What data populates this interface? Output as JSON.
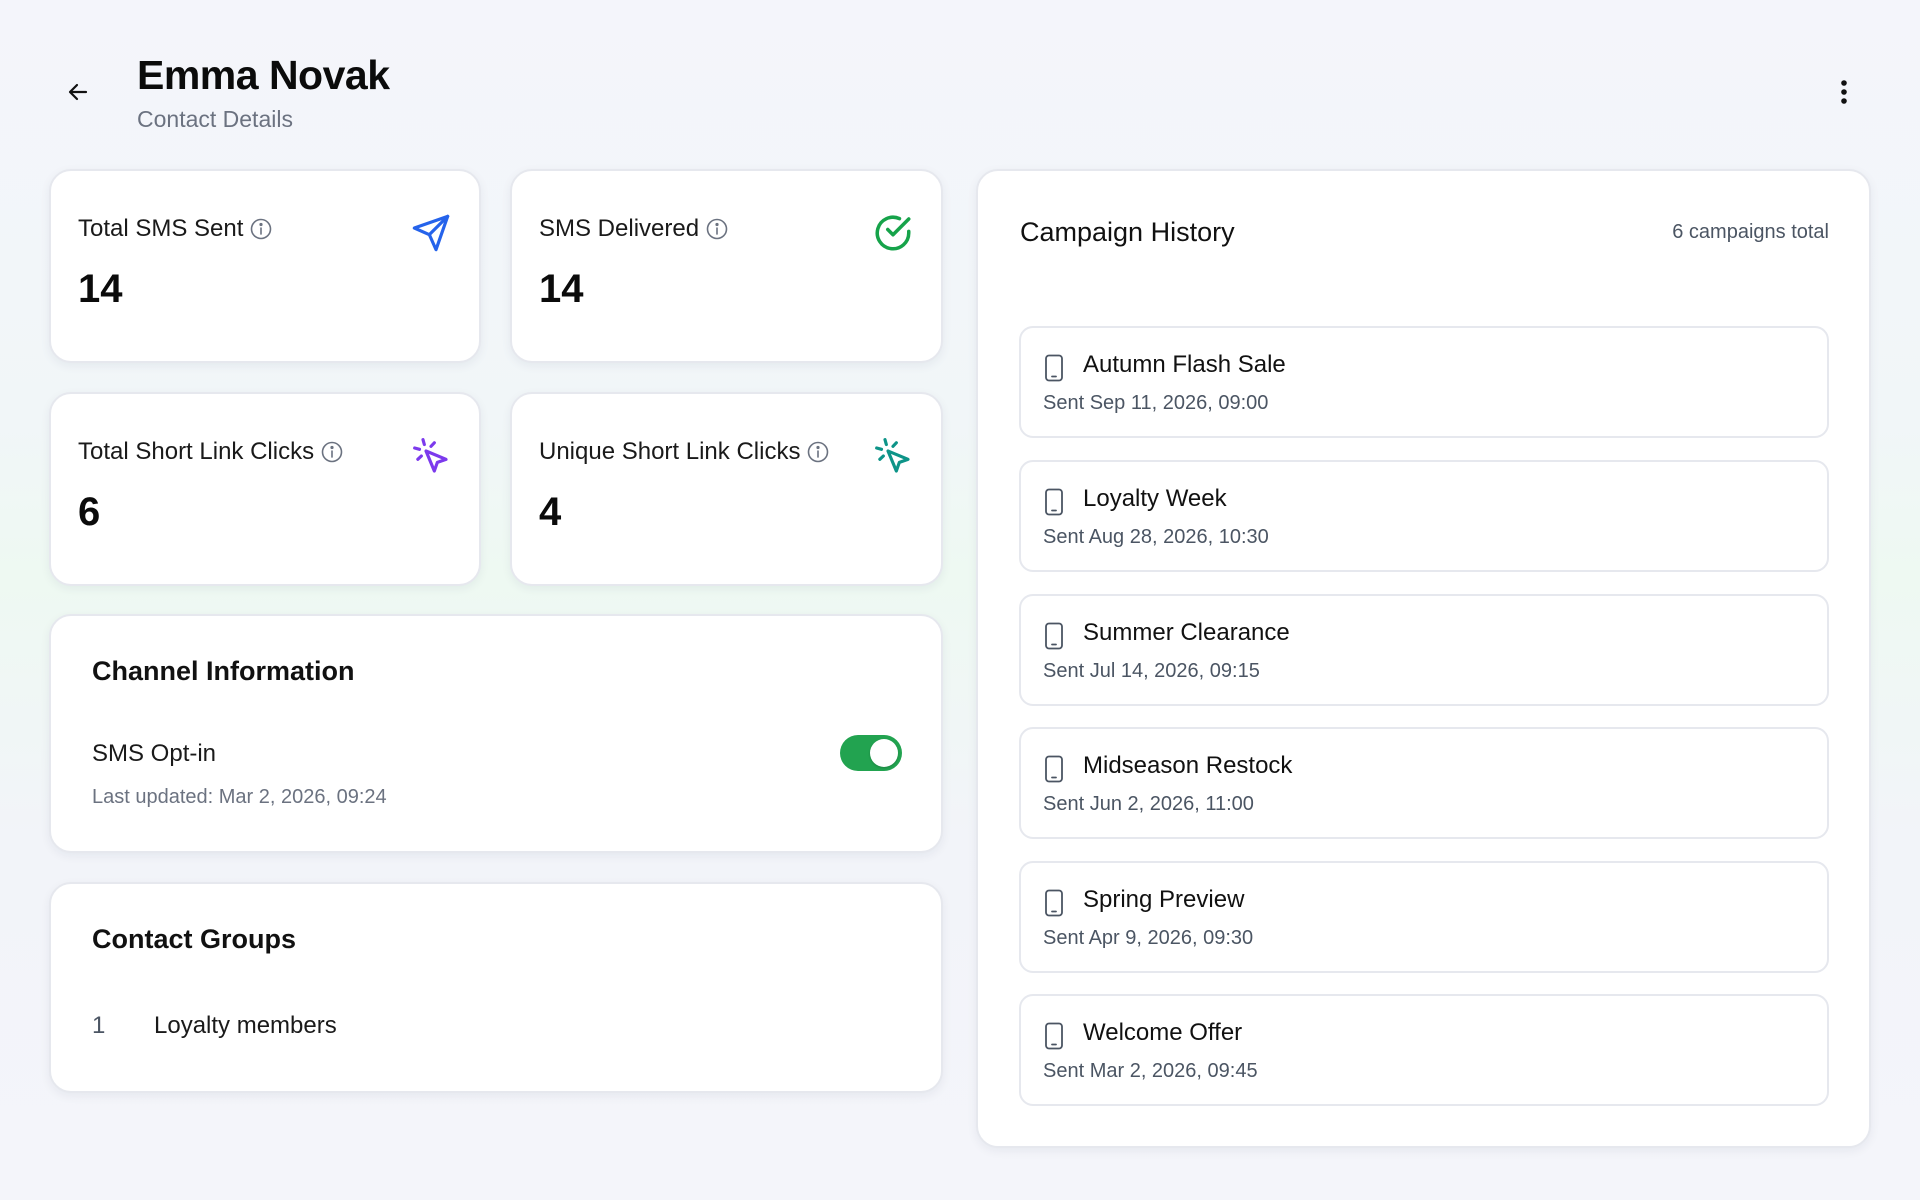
{
  "header": {
    "title": "Emma Novak",
    "subtitle": "Contact Details"
  },
  "stats": [
    {
      "label": "Total SMS Sent",
      "value": "14",
      "icon": "send-icon",
      "color": "#2563eb"
    },
    {
      "label": "SMS Delivered",
      "value": "14",
      "icon": "check-circle-icon",
      "color": "#16a34a"
    },
    {
      "label": "Total Short Link Clicks",
      "value": "6",
      "icon": "cursor-click-icon",
      "color": "#7c3aed"
    },
    {
      "label": "Unique Short Link Clicks",
      "value": "4",
      "icon": "cursor-click-icon",
      "color": "#0d9488"
    }
  ],
  "channel": {
    "title": "Channel Information",
    "optin_label": "SMS Opt-in",
    "optin_enabled": true,
    "updated": "Last updated: Mar 2, 2026, 09:24",
    "toggle_color": "#22a350"
  },
  "groups": {
    "title": "Contact Groups",
    "items": [
      {
        "index": "1",
        "name": "Loyalty members"
      }
    ]
  },
  "campaigns": {
    "title": "Campaign History",
    "count": "6 campaigns total",
    "items": [
      {
        "name": "Autumn Flash Sale",
        "date": "Sent Sep 11, 2026, 09:00"
      },
      {
        "name": "Loyalty Week",
        "date": "Sent Aug 28, 2026, 10:30"
      },
      {
        "name": "Summer Clearance",
        "date": "Sent Jul 14, 2026, 09:15"
      },
      {
        "name": "Midseason Restock",
        "date": "Sent Jun 2, 2026, 11:00"
      },
      {
        "name": "Spring Preview",
        "date": "Sent Apr 9, 2026, 09:30"
      },
      {
        "name": "Welcome Offer",
        "date": "Sent Mar 2, 2026, 09:45"
      }
    ]
  }
}
